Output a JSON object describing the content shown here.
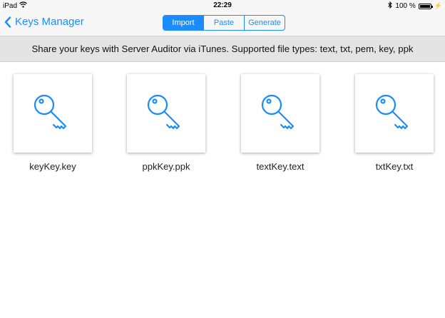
{
  "status_bar": {
    "device": "iPad",
    "time": "22:29",
    "battery_percent": "100 %",
    "battery_level": 1.0
  },
  "nav": {
    "back_label": "Keys Manager",
    "segments": [
      {
        "label": "Import",
        "active": true
      },
      {
        "label": "Paste",
        "active": false
      },
      {
        "label": "Generate",
        "active": false
      }
    ]
  },
  "banner": {
    "text": "Share your keys with Server Auditor via iTunes. Supported file types: text, txt, pem, key, ppk"
  },
  "files": [
    {
      "name": "keyKey.key",
      "icon": "key-icon"
    },
    {
      "name": "ppkKey.ppk",
      "icon": "key-icon"
    },
    {
      "name": "textKey.text",
      "icon": "key-icon"
    },
    {
      "name": "txtKey.txt",
      "icon": "key-icon"
    }
  ],
  "colors": {
    "accent": "#1a8cff",
    "bar_background": "#f7f7f7",
    "banner_background": "#e4e4e4"
  }
}
